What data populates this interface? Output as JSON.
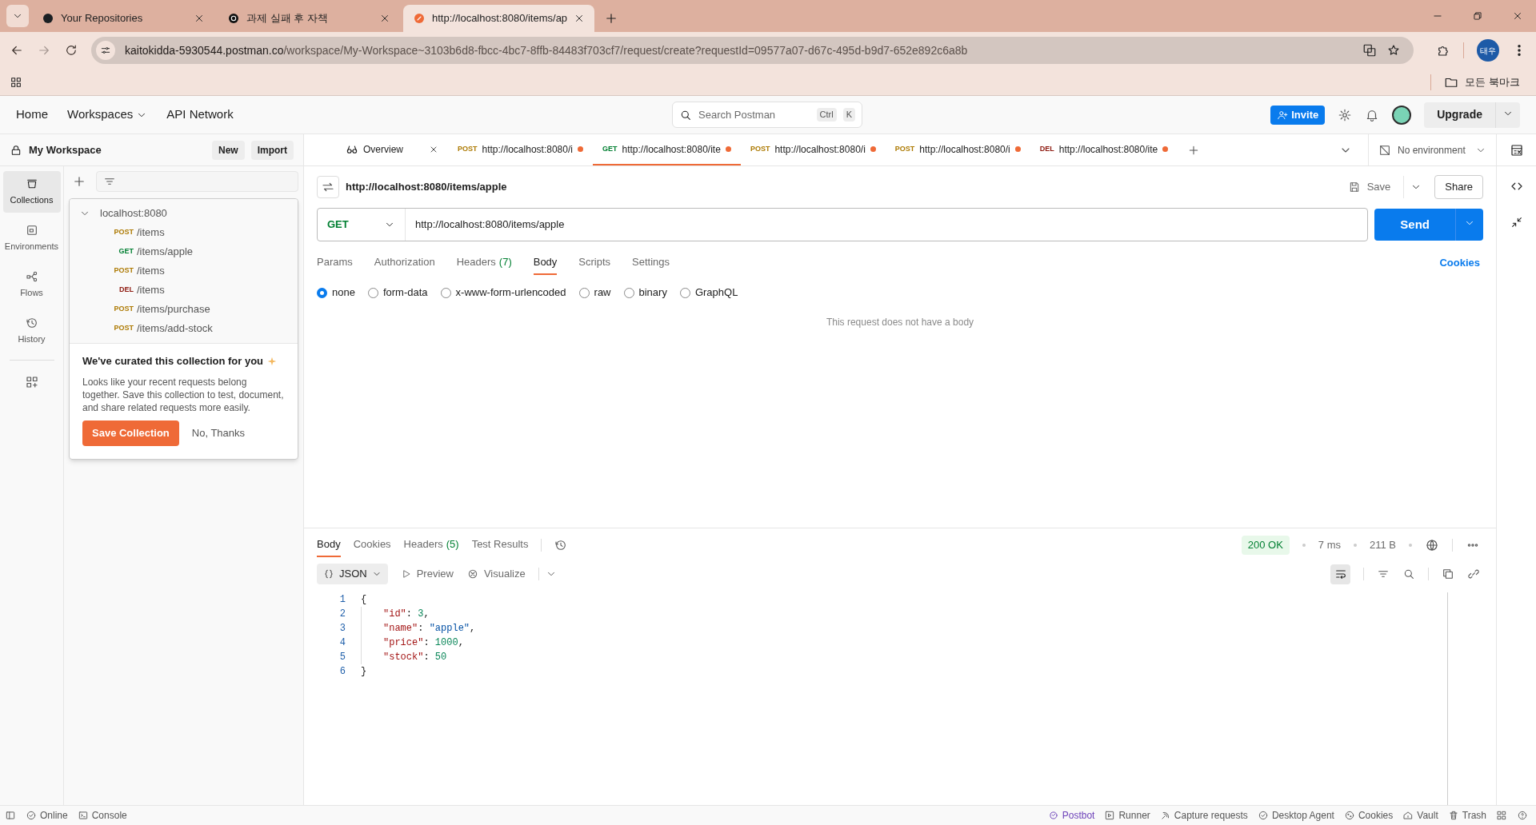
{
  "browser": {
    "tabs": [
      {
        "title": "Your Repositories",
        "selected": false
      },
      {
        "title": "과제 실패 후 자책",
        "selected": false
      },
      {
        "title": "http://localhost:8080/items/ap",
        "selected": true
      }
    ],
    "address": {
      "host": "kaitokidda-5930544.postman.co",
      "path": "/workspace/My-Workspace~3103b6d8-fbcc-4bc7-8ffb-84483f703cf7/request/create?requestId=09577a07-d67c-495d-b9d7-652e892c6a8b"
    },
    "profile": "태우",
    "bookmarks_folder": "모든 북마크"
  },
  "header": {
    "nav": [
      "Home",
      "Workspaces",
      "API Network"
    ],
    "search": {
      "placeholder": "Search Postman",
      "shortcut": [
        "Ctrl",
        "K"
      ]
    },
    "invite": "Invite",
    "upgrade": "Upgrade"
  },
  "workspace": {
    "title": "My Workspace",
    "buttons": [
      "New",
      "Import"
    ]
  },
  "rail": [
    {
      "label": "Collections",
      "selected": true
    },
    {
      "label": "Environments",
      "selected": false
    },
    {
      "label": "Flows",
      "selected": false
    },
    {
      "label": "History",
      "selected": false
    }
  ],
  "tree": [
    {
      "name": "localhost:8080",
      "expanded": true,
      "children": [
        {
          "method": "POST",
          "path": "/items",
          "selected": false
        },
        {
          "method": "GET",
          "path": "/items/apple",
          "selected": false
        },
        {
          "method": "POST",
          "path": "/items",
          "selected": false
        },
        {
          "method": "DEL",
          "path": "/items",
          "selected": false
        },
        {
          "method": "POST",
          "path": "/items/purchase",
          "selected": false
        },
        {
          "method": "POST",
          "path": "/items/add-stock",
          "selected": false
        }
      ]
    }
  ],
  "curated": {
    "title": "We've curated this collection for you",
    "text": "Looks like your recent requests belong together. Save this collection to test, document, and share related requests more easily.",
    "primary": "Save Collection",
    "secondary": "No, Thanks"
  },
  "request_tabs": [
    {
      "kind": "overview",
      "label": "Overview",
      "selected": false
    },
    {
      "kind": "request",
      "method": "POST",
      "url": "http://localhost:8080/i",
      "unsaved": true,
      "selected": false
    },
    {
      "kind": "request",
      "method": "GET",
      "url": "http://localhost:8080/ite",
      "unsaved": true,
      "selected": true
    },
    {
      "kind": "request",
      "method": "POST",
      "url": "http://localhost:8080/i",
      "unsaved": true,
      "selected": false
    },
    {
      "kind": "request",
      "method": "POST",
      "url": "http://localhost:8080/i",
      "unsaved": true,
      "selected": false
    },
    {
      "kind": "request",
      "method": "DEL",
      "url": "http://localhost:8080/ite",
      "unsaved": true,
      "selected": false
    }
  ],
  "environment": "No environment",
  "request": {
    "title": "http://localhost:8080/items/apple",
    "save": "Save",
    "share": "Share",
    "method": "GET",
    "url": "http://localhost:8080/items/apple",
    "send": "Send",
    "tabs": [
      {
        "label": "Params",
        "selected": false
      },
      {
        "label": "Authorization",
        "selected": false
      },
      {
        "label": "Headers",
        "count": "(7)",
        "selected": false
      },
      {
        "label": "Body",
        "selected": true
      },
      {
        "label": "Scripts",
        "selected": false
      },
      {
        "label": "Settings",
        "selected": false
      }
    ],
    "cookies": "Cookies",
    "body_types": [
      {
        "label": "none",
        "selected": true
      },
      {
        "label": "form-data",
        "selected": false
      },
      {
        "label": "x-www-form-urlencoded",
        "selected": false
      },
      {
        "label": "raw",
        "selected": false
      },
      {
        "label": "binary",
        "selected": false
      },
      {
        "label": "GraphQL",
        "selected": false
      }
    ],
    "empty_message": "This request does not have a body"
  },
  "response": {
    "tabs": [
      {
        "label": "Body",
        "selected": true
      },
      {
        "label": "Cookies",
        "selected": false
      },
      {
        "label": "Headers",
        "count": "(5)",
        "selected": false
      },
      {
        "label": "Test Results",
        "selected": false
      }
    ],
    "status": "200 OK",
    "time": "7 ms",
    "size": "211 B",
    "format": "JSON",
    "preview": "Preview",
    "visualize": "Visualize",
    "lines": [
      {
        "number": "1",
        "tokens": [
          {
            "kind": "punct",
            "text": "{"
          }
        ]
      },
      {
        "number": "2",
        "tokens": [
          {
            "kind": "key",
            "text": "\"id\""
          },
          {
            "kind": "punct",
            "text": ": "
          },
          {
            "kind": "number",
            "text": "3"
          },
          {
            "kind": "punct",
            "text": ","
          }
        ]
      },
      {
        "number": "3",
        "tokens": [
          {
            "kind": "key",
            "text": "\"name\""
          },
          {
            "kind": "punct",
            "text": ": "
          },
          {
            "kind": "string",
            "text": "\"apple\""
          },
          {
            "kind": "punct",
            "text": ","
          }
        ]
      },
      {
        "number": "4",
        "tokens": [
          {
            "kind": "key",
            "text": "\"price\""
          },
          {
            "kind": "punct",
            "text": ": "
          },
          {
            "kind": "number",
            "text": "1000"
          },
          {
            "kind": "punct",
            "text": ","
          }
        ]
      },
      {
        "number": "5",
        "tokens": [
          {
            "kind": "key",
            "text": "\"stock\""
          },
          {
            "kind": "punct",
            "text": ": "
          },
          {
            "kind": "number",
            "text": "50"
          }
        ]
      },
      {
        "number": "6",
        "tokens": [
          {
            "kind": "punct",
            "text": "}"
          }
        ]
      }
    ]
  },
  "status_bar": {
    "left": [
      "Online",
      "Console"
    ],
    "right": [
      "Postbot",
      "Runner",
      "Capture requests",
      "Desktop Agent",
      "Cookies",
      "Vault",
      "Trash"
    ]
  }
}
